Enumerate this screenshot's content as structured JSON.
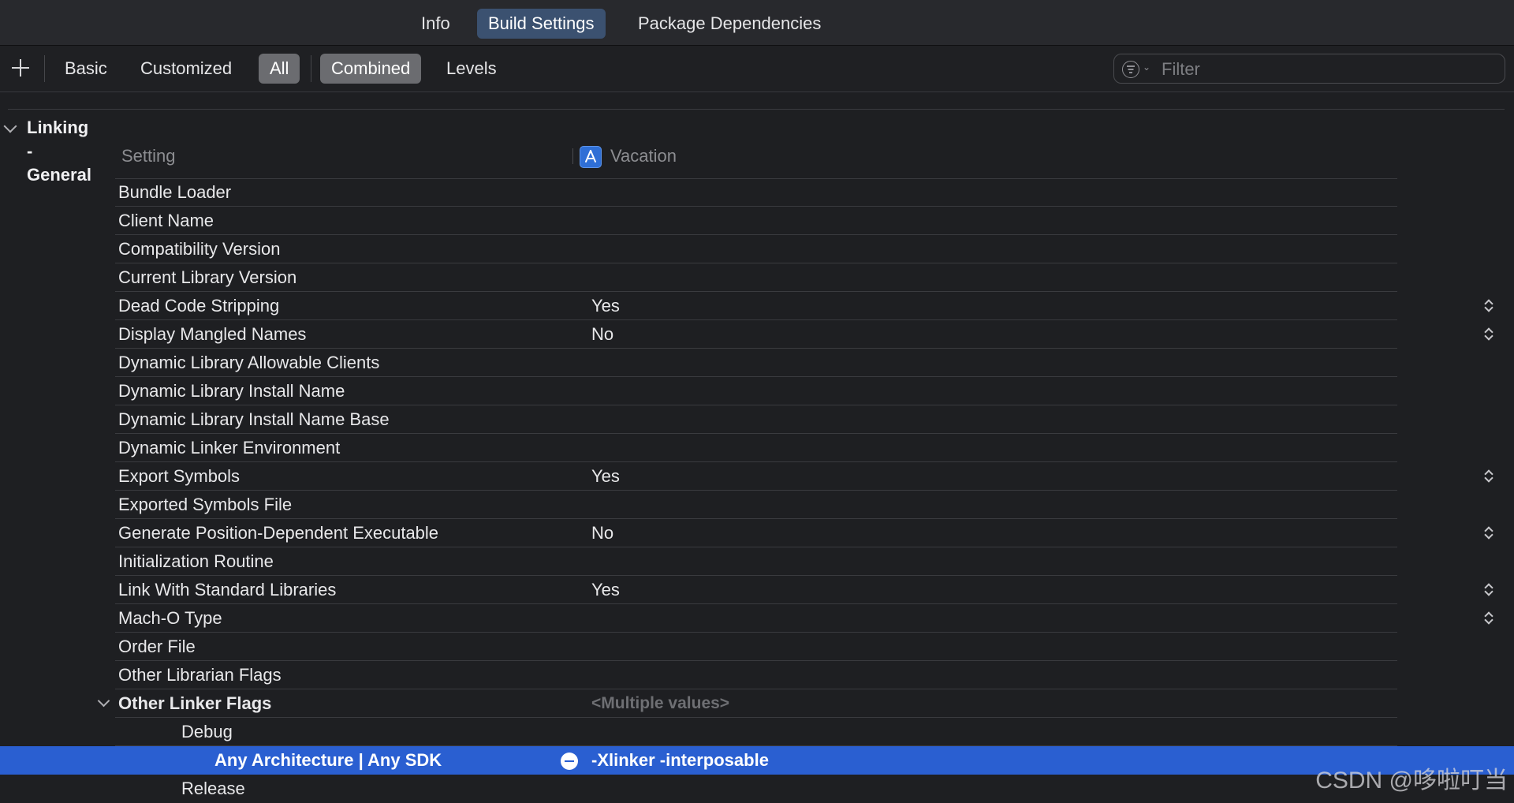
{
  "tabs": {
    "info": "Info",
    "build_settings": "Build Settings",
    "package_dependencies": "Package Dependencies"
  },
  "toolbar": {
    "basic": "Basic",
    "customized": "Customized",
    "all": "All",
    "combined": "Combined",
    "levels": "Levels",
    "filter_placeholder": "Filter"
  },
  "section": {
    "title": "Linking - General",
    "col_setting": "Setting",
    "col_target": "Vacation"
  },
  "rows": [
    {
      "name": "Bundle Loader",
      "value": ""
    },
    {
      "name": "Client Name",
      "value": ""
    },
    {
      "name": "Compatibility Version",
      "value": ""
    },
    {
      "name": "Current Library Version",
      "value": ""
    },
    {
      "name": "Dead Code Stripping",
      "value": "Yes"
    },
    {
      "name": "Display Mangled Names",
      "value": "No"
    },
    {
      "name": "Dynamic Library Allowable Clients",
      "value": ""
    },
    {
      "name": "Dynamic Library Install Name",
      "value": ""
    },
    {
      "name": "Dynamic Library Install Name Base",
      "value": ""
    },
    {
      "name": "Dynamic Linker Environment",
      "value": ""
    },
    {
      "name": "Export Symbols",
      "value": "Yes"
    },
    {
      "name": "Exported Symbols File",
      "value": ""
    },
    {
      "name": "Generate Position-Dependent Executable",
      "value": "No"
    },
    {
      "name": "Initialization Routine",
      "value": ""
    },
    {
      "name": "Link With Standard Libraries",
      "value": "Yes"
    },
    {
      "name": "Mach-O Type",
      "value": ""
    },
    {
      "name": "Order File",
      "value": ""
    },
    {
      "name": "Other Librarian Flags",
      "value": ""
    },
    {
      "name": "Other Linker Flags",
      "value": "<Multiple values>"
    },
    {
      "name": "Debug",
      "value": ""
    },
    {
      "name": "Any Architecture | Any SDK",
      "value": "-Xlinker -interposable"
    },
    {
      "name": "Release",
      "value": ""
    }
  ],
  "watermark": "CSDN @哆啦叮当"
}
